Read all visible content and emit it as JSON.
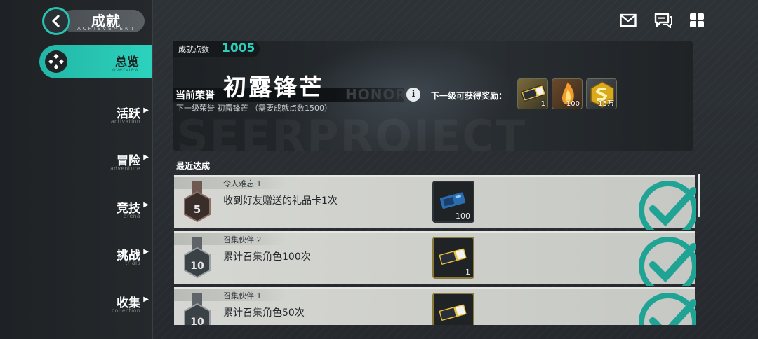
{
  "header": {
    "title": "成就",
    "subtitle": "ACHIEVEMENT"
  },
  "sidebar": {
    "items": [
      {
        "label": "总览",
        "sub": "overview",
        "active": true
      },
      {
        "label": "活跃",
        "sub": "activation"
      },
      {
        "label": "冒险",
        "sub": "adventure"
      },
      {
        "label": "竞技",
        "sub": "arena"
      },
      {
        "label": "挑战",
        "sub": "trials"
      },
      {
        "label": "收集",
        "sub": "collection"
      }
    ]
  },
  "top_icons": [
    "mail-icon",
    "chat-icon",
    "grid-menu-icon"
  ],
  "banner": {
    "points_label": "成就点数",
    "points_value": "1005",
    "honor_label": "当前荣誉",
    "honor_name": "初露锋芒",
    "honor_en": "HONOR",
    "next_honor": "下一级荣誉 初露锋芒 （需要成就点数1500）",
    "reward_label": "下一级可获得奖励：",
    "watermark": "SEERPROJECT",
    "rewards": [
      {
        "icon": "ticket-icon",
        "count": "1"
      },
      {
        "icon": "flame-crystal-icon",
        "count": "100"
      },
      {
        "icon": "gold-coin-icon",
        "count": "15万"
      }
    ]
  },
  "recent": {
    "title": "最近达成",
    "items": [
      {
        "category": "令人难忘·1",
        "desc": "收到好友赠送的礼品卡1次",
        "medal_level": "5",
        "reward_icon": "gift-card-icon",
        "reward_count": "100",
        "completed": true
      },
      {
        "category": "召集伙伴·2",
        "desc": "累计召集角色100次",
        "medal_level": "10",
        "reward_icon": "ticket-icon",
        "reward_count": "1",
        "completed": true
      },
      {
        "category": "召集伙伴·1",
        "desc": "累计召集角色50次",
        "medal_level": "10",
        "reward_icon": "ticket-icon",
        "reward_count": "",
        "completed": true
      }
    ]
  },
  "colors": {
    "accent": "#2ad0bb",
    "bg": "#2b3034",
    "row_bg": "#d6d7d3",
    "check": "#1fa394"
  }
}
